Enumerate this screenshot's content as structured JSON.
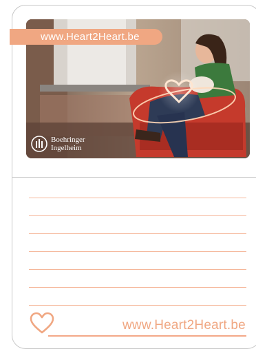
{
  "header": {
    "url_text": "www.Heart2Heart.be"
  },
  "logo": {
    "line1": "Boehringer",
    "line2": "Ingelheim"
  },
  "notes": {
    "line_count": 7
  },
  "footer": {
    "url_text": "www.Heart2Heart.be"
  },
  "colors": {
    "accent": "#f0a782",
    "rule": "#f5b79a",
    "border": "#c7c7c7"
  },
  "icons": {
    "footer_icon": "heart-outline-icon",
    "logo_icon": "boehringer-logo-icon"
  }
}
